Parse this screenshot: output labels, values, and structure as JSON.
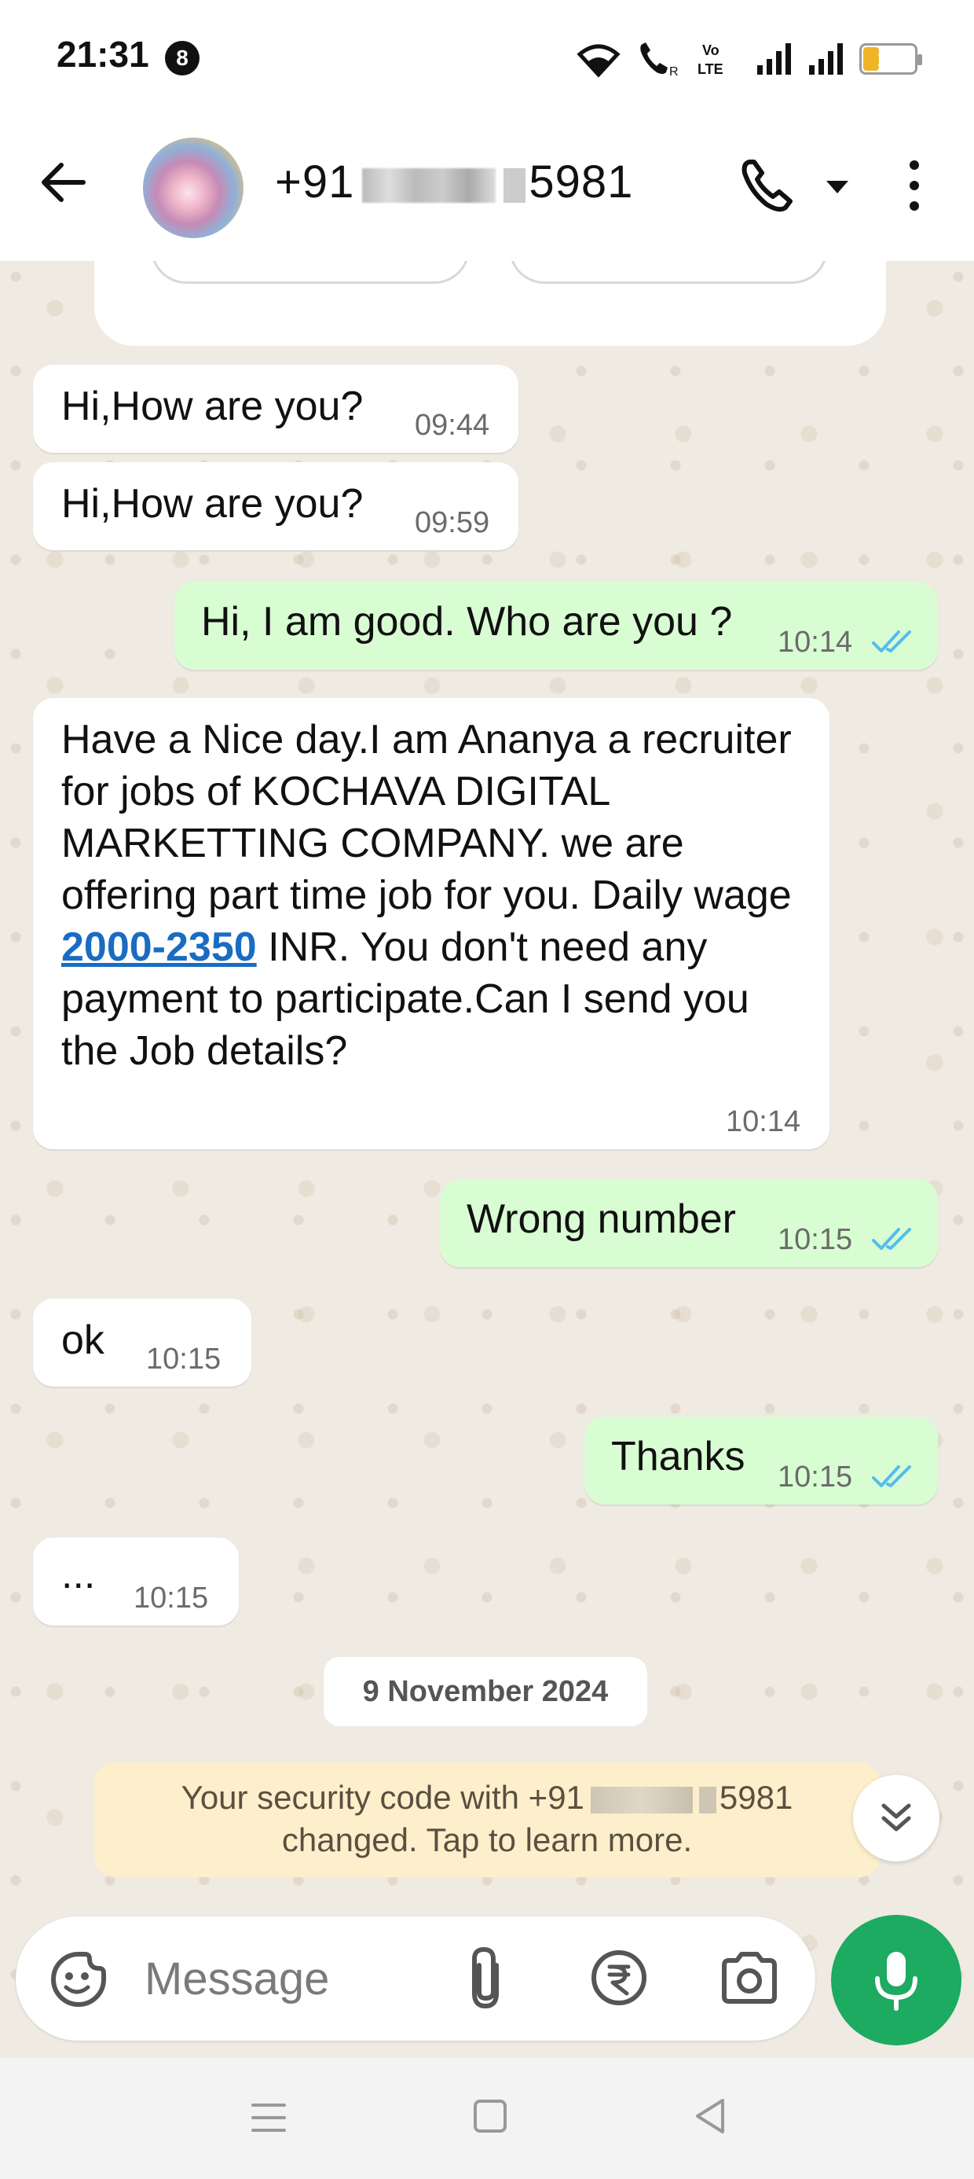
{
  "status_bar": {
    "time": "21:31",
    "notification_count": "8",
    "icons": [
      "wifi-icon",
      "wifi-calling-icon",
      "volte-icon",
      "signal-icon",
      "signal-icon",
      "battery-icon"
    ],
    "volte_label": "Vo LTE",
    "battery_level": "12"
  },
  "header": {
    "contact_prefix": "+91",
    "contact_suffix": "5981",
    "icons": [
      "back-arrow-icon",
      "phone-icon",
      "dropdown-icon",
      "more-vert-icon"
    ]
  },
  "messages": [
    {
      "direction": "in",
      "text": "Hi,How are you?",
      "time": "09:44"
    },
    {
      "direction": "in",
      "text": "Hi,How are you?",
      "time": "09:59"
    },
    {
      "direction": "out",
      "text": "Hi, I am good. Who are you ?",
      "time": "10:14",
      "status": "read"
    },
    {
      "direction": "in",
      "text_before_link": "Have a Nice day.I am Ananya a recruiter for jobs of KOCHAVA DIGITAL MARKETTING COMPANY. we are offering part time job for you. Daily wage ",
      "link": "2000-2350",
      "text_after_link": " INR. You don't need any payment to participate.Can I send you the Job details?",
      "time": "10:14"
    },
    {
      "direction": "out",
      "text": "Wrong number",
      "time": "10:15",
      "status": "read"
    },
    {
      "direction": "in",
      "text": "ok",
      "time": "10:15"
    },
    {
      "direction": "out",
      "text": "Thanks",
      "time": "10:15",
      "status": "read"
    },
    {
      "direction": "in",
      "text": "...",
      "time": "10:15"
    }
  ],
  "date_separator": "9 November 2024",
  "security_notice": {
    "line1_prefix": "Your security code with +91",
    "line1_suffix": "5981",
    "line2": "changed. Tap to learn more."
  },
  "input_bar": {
    "placeholder": "Message",
    "icons": [
      "sticker-emoji-icon",
      "attach-icon",
      "rupee-payment-icon",
      "camera-icon",
      "mic-icon"
    ]
  },
  "nav_bar": {
    "icons": [
      "recent-apps-icon",
      "home-icon",
      "back-icon"
    ]
  },
  "colors": {
    "incoming_bubble": "#ffffff",
    "outgoing_bubble": "#d9fdd3",
    "chat_background": "#efeae2",
    "mic_button": "#1daa61",
    "read_ticks": "#53bdeb",
    "link": "#1a6cc2",
    "security_notice_bg": "#fdefcc"
  }
}
